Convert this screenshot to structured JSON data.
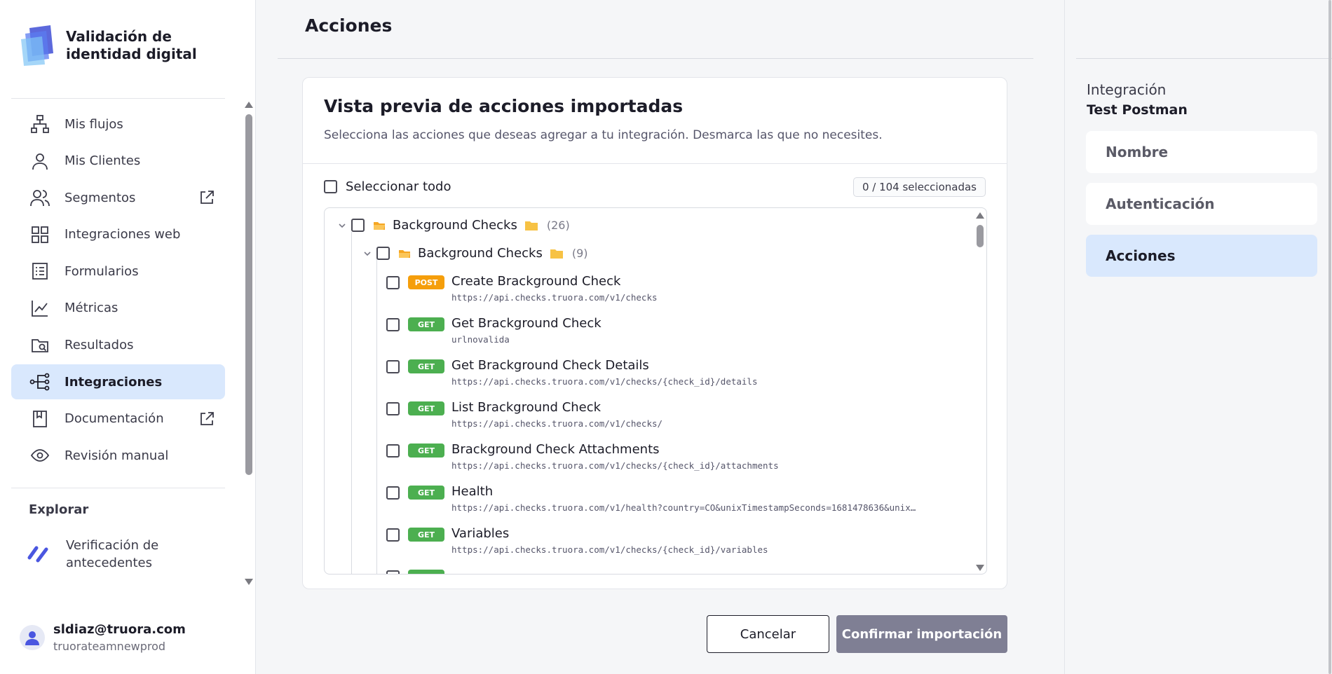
{
  "brand": {
    "title": "Validación de identidad digital"
  },
  "sidebar": {
    "items": [
      {
        "label": "Mis flujos",
        "icon": "flow-icon"
      },
      {
        "label": "Mis Clientes",
        "icon": "user-icon"
      },
      {
        "label": "Segmentos",
        "icon": "users-icon",
        "external": true
      },
      {
        "label": "Integraciones web",
        "icon": "grid-icon"
      },
      {
        "label": "Formularios",
        "icon": "form-icon"
      },
      {
        "label": "Métricas",
        "icon": "chart-icon"
      },
      {
        "label": "Resultados",
        "icon": "folder-search-icon"
      },
      {
        "label": "Integraciones",
        "icon": "integration-icon",
        "active": true
      },
      {
        "label": "Documentación",
        "icon": "book-icon",
        "external": true
      },
      {
        "label": "Revisión manual",
        "icon": "eye-icon"
      }
    ],
    "explore_title": "Explorar",
    "explore_item": "Verificación de antecedentes"
  },
  "user": {
    "email": "sldiaz@truora.com",
    "org": "truorateamnewprod"
  },
  "main": {
    "title": "Acciones",
    "card_title": "Vista previa de acciones importadas",
    "card_subtitle": "Selecciona las acciones que deseas agregar a tu integración. Desmarca las que no necesites.",
    "select_all": "Seleccionar todo",
    "selected_count": "0 / 104 seleccionadas",
    "group": {
      "label": "Background Checks",
      "count": "(26)"
    },
    "subgroup": {
      "label": "Background Checks",
      "count": "(9)"
    },
    "actions": [
      {
        "method": "POST",
        "name": "Create Brackground Check",
        "url": "https://api.checks.truora.com/v1/checks"
      },
      {
        "method": "GET",
        "name": "Get Brackground Check",
        "url": "urlnovalida"
      },
      {
        "method": "GET",
        "name": "Get Brackground Check Details",
        "url": "https://api.checks.truora.com/v1/checks/{check_id}/details"
      },
      {
        "method": "GET",
        "name": "List Brackground Check",
        "url": "https://api.checks.truora.com/v1/checks/"
      },
      {
        "method": "GET",
        "name": "Brackground Check Attachments",
        "url": "https://api.checks.truora.com/v1/checks/{check_id}/attachments"
      },
      {
        "method": "GET",
        "name": "Health",
        "url": "https://api.checks.truora.com/v1/health?country=CO&unixTimestampSeconds=1681478636&unix…"
      },
      {
        "method": "GET",
        "name": "Variables",
        "url": "https://api.checks.truora.com/v1/checks/{check_id}/variables"
      }
    ],
    "cancel_label": "Cancelar",
    "confirm_label": "Confirmar importación"
  },
  "right": {
    "integration_label": "Integración",
    "integration_name": "Test Postman",
    "steps": [
      {
        "label": "Nombre"
      },
      {
        "label": "Autenticación"
      },
      {
        "label": "Acciones",
        "active": true
      }
    ]
  },
  "colors": {
    "active_bg": "#d9e8fd",
    "post": "#f59e0b",
    "get": "#4caf50",
    "confirm_disabled": "#7f7f94"
  }
}
